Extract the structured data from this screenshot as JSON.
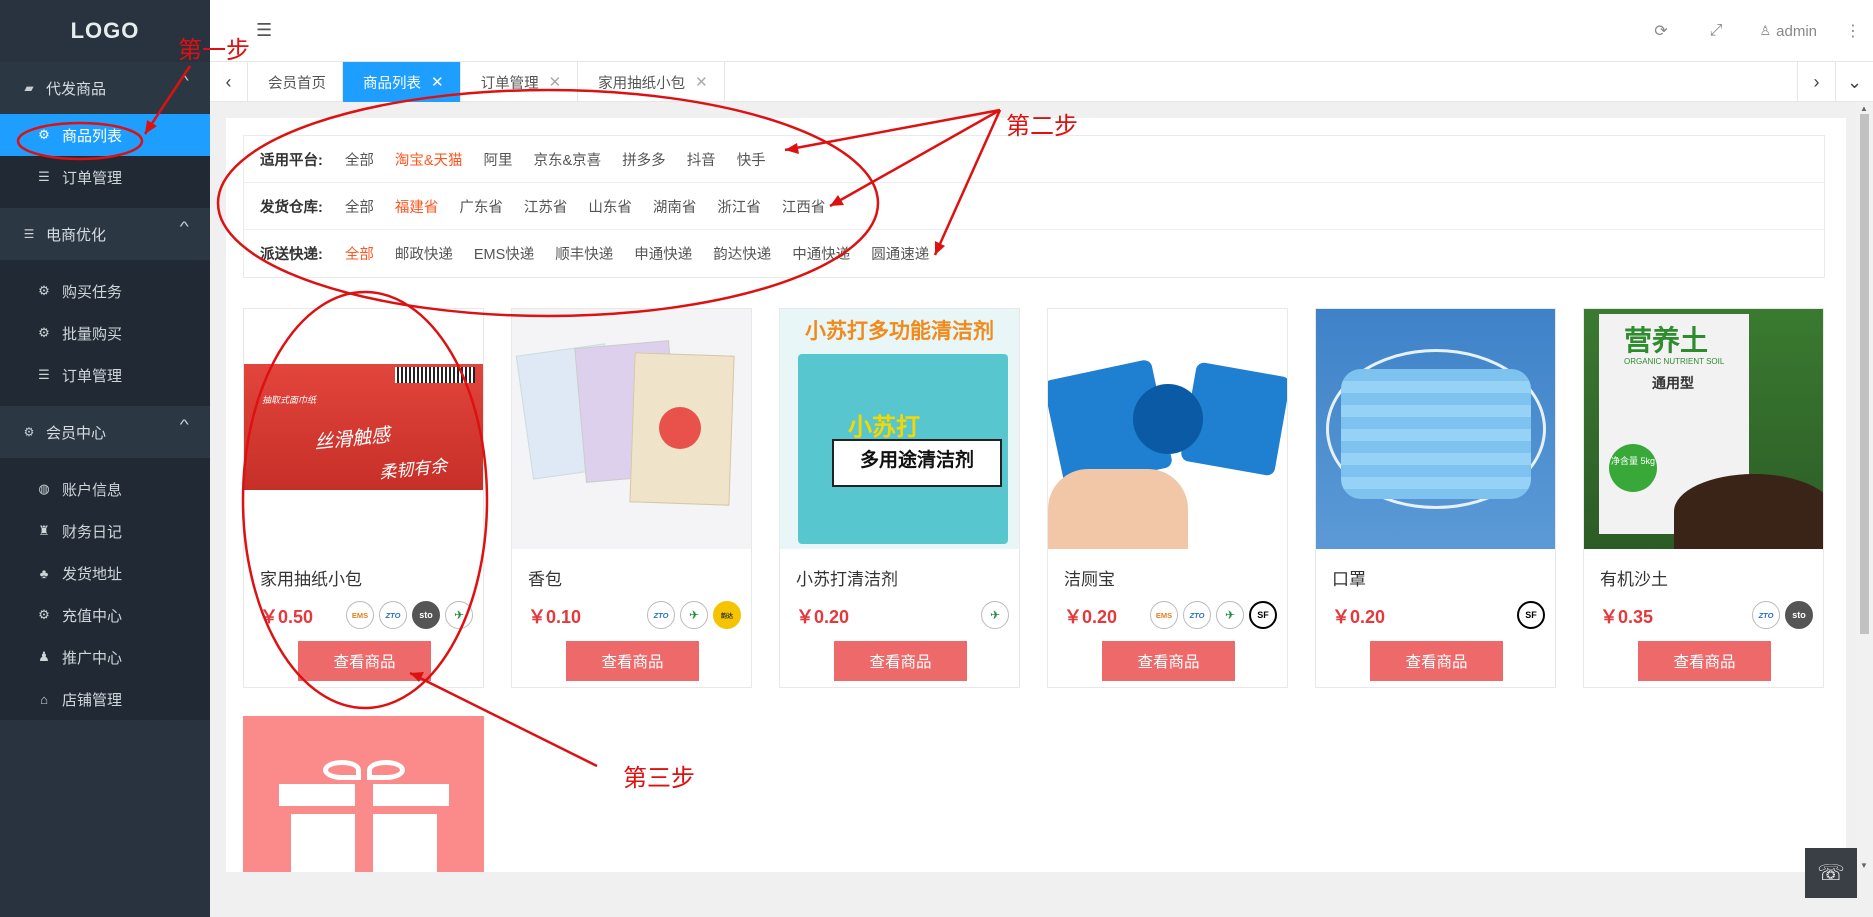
{
  "sidebar": {
    "logo": "LOGO",
    "groups": [
      {
        "label": "代发商品",
        "items": [
          {
            "label": "商品列表",
            "active": true
          },
          {
            "label": "订单管理"
          }
        ]
      },
      {
        "label": "电商优化",
        "items": [
          {
            "label": "购买任务"
          },
          {
            "label": "批量购买"
          },
          {
            "label": "订单管理"
          }
        ]
      },
      {
        "label": "会员中心",
        "items": [
          {
            "label": "账户信息"
          },
          {
            "label": "财务日记"
          },
          {
            "label": "发货地址"
          },
          {
            "label": "充值中心"
          },
          {
            "label": "推广中心"
          },
          {
            "label": "店铺管理"
          }
        ]
      }
    ]
  },
  "topbar": {
    "user": "admin"
  },
  "tabs": [
    {
      "label": "会员首页"
    },
    {
      "label": "商品列表",
      "active": true
    },
    {
      "label": "订单管理"
    },
    {
      "label": "家用抽纸小包"
    }
  ],
  "filters": [
    {
      "label": "适用平台:",
      "options": [
        "全部",
        "淘宝&天猫",
        "阿里",
        "京东&京喜",
        "拼多多",
        "抖音",
        "快手"
      ],
      "selected": "淘宝&天猫"
    },
    {
      "label": "发货仓库:",
      "options": [
        "全部",
        "福建省",
        "广东省",
        "江苏省",
        "山东省",
        "湖南省",
        "浙江省",
        "江西省"
      ],
      "selected": "福建省"
    },
    {
      "label": "派送快递:",
      "options": [
        "全部",
        "邮政快递",
        "EMS快递",
        "顺丰快递",
        "申通快递",
        "韵达快递",
        "中通快递",
        "圆通速递"
      ],
      "selected": "全部"
    }
  ],
  "products": [
    {
      "name": "家用抽纸小包",
      "price": "￥0.50",
      "button": "查看商品",
      "couriers": [
        "ems",
        "zto",
        "sto",
        "china-post"
      ],
      "art_text": [
        "抽取式面巾纸",
        "丝滑触感",
        "柔韧有余"
      ]
    },
    {
      "name": "香包",
      "price": "￥0.10",
      "button": "查看商品",
      "couriers": [
        "zto",
        "china-post",
        "yunda"
      ]
    },
    {
      "name": "小苏打清洁剂",
      "price": "￥0.20",
      "button": "查看商品",
      "couriers": [
        "china-post"
      ],
      "art_text": [
        "小苏打多功能清洁剂",
        "小苏打",
        "多用途清洁剂"
      ]
    },
    {
      "name": "洁厕宝",
      "price": "￥0.20",
      "button": "查看商品",
      "couriers": [
        "ems",
        "zto",
        "china-post",
        "sf"
      ]
    },
    {
      "name": "口罩",
      "price": "￥0.20",
      "button": "查看商品",
      "couriers": [
        "sf"
      ]
    },
    {
      "name": "有机沙土",
      "price": "￥0.35",
      "button": "查看商品",
      "couriers": [
        "zto",
        "sto"
      ],
      "art_text": [
        "营养土",
        "ORGANIC NUTRIENT SOIL",
        "通用型",
        "净含量 5kg"
      ]
    }
  ],
  "badge_text": {
    "ems": "EMS",
    "zto": "ZTO",
    "sto": "sto",
    "china-post": "✈",
    "yunda": "韵达",
    "sf": "SF"
  },
  "annotations": {
    "step1": "第一步",
    "step2": "第二步",
    "step3": "第三步",
    "color": "#dd1111"
  }
}
